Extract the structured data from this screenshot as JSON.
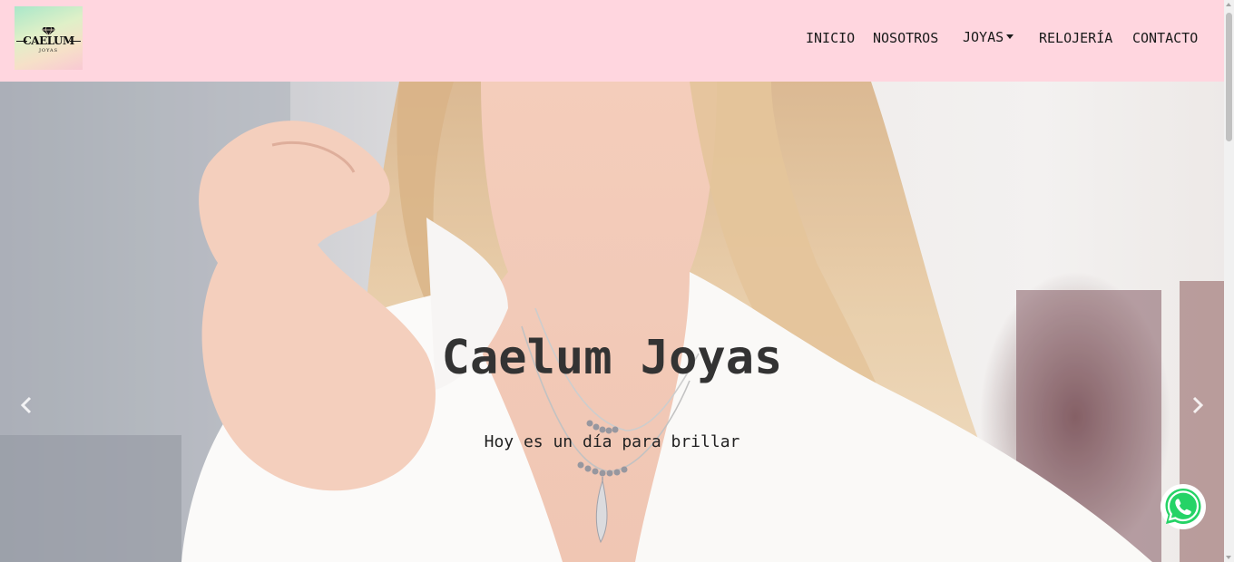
{
  "logo": {
    "brand": "CAELUM",
    "subtitle": "JOYAS"
  },
  "nav": {
    "items": [
      {
        "label": "INICIO"
      },
      {
        "label": "NOSOTROS"
      },
      {
        "label": "JOYAS"
      },
      {
        "label": "RELOJERÍA"
      },
      {
        "label": "CONTACTO"
      }
    ]
  },
  "hero": {
    "title": "Caelum Joyas",
    "subtitle": "Hoy es un día para brillar"
  },
  "icons": {
    "dropdown": "caret-down-icon",
    "prev": "chevron-left-icon",
    "next": "chevron-right-icon",
    "whatsapp": "whatsapp-icon"
  },
  "colors": {
    "navbar_bg": "#ffd6df",
    "whatsapp_green": "#25d366",
    "title_text": "#333333"
  }
}
